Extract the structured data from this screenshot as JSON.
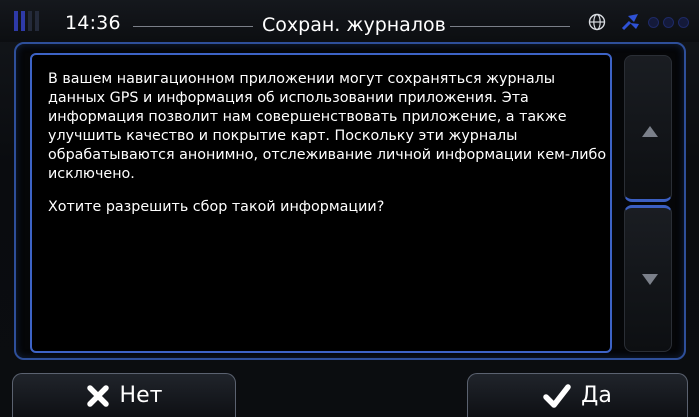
{
  "status": {
    "time": "14:36",
    "title": "Сохран. журналов",
    "icons": [
      "signal-icon",
      "globe-icon",
      "satellite-icon",
      "gps-dots-icon"
    ]
  },
  "dialog": {
    "paragraph1": "В вашем навигационном приложении могут сохраняться журналы данных GPS и информация об использовании приложения. Эта информация позволит нам совершенствовать приложение, а также улучшить качество и покрытие карт. Поскольку эти журналы обрабатываются анонимно, отслеживание личной информации кем-либо исключено.",
    "paragraph2": "Хотите разрешить сбор такой информации?"
  },
  "buttons": {
    "no_label": "Нет",
    "yes_label": "Да"
  },
  "colors": {
    "accent_blue": "#3d63c6",
    "background": "#000000",
    "text": "#ffffff"
  }
}
